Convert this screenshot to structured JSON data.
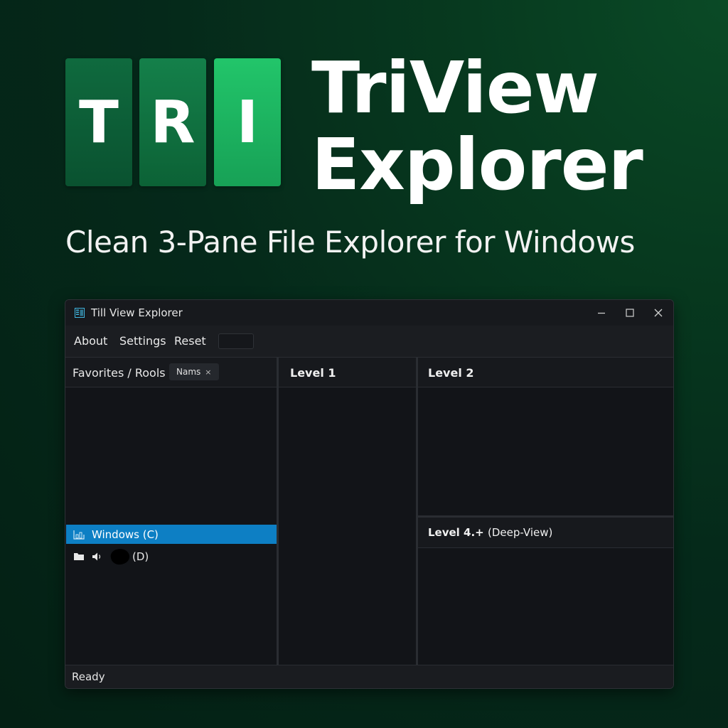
{
  "logo": {
    "letters": [
      "T",
      "R",
      "I"
    ],
    "colors": [
      "#0f6a3e",
      "#14804a",
      "#22c56a"
    ]
  },
  "brand": {
    "line1": "TriView",
    "line2": "Explorer"
  },
  "tagline": "Clean 3-Pane File Explorer for Windows",
  "window": {
    "title": "Till View Explorer",
    "icon": "app-window-icon",
    "controls": {
      "minimize": "—",
      "maximize": "☐",
      "close": "✕"
    }
  },
  "menu": {
    "about": "About",
    "settings": "Settings",
    "reset": "Reset"
  },
  "panes": {
    "favorites": {
      "title": "Favorites / Rools",
      "chip_label": "Nams",
      "chip_close": "×",
      "items": [
        {
          "label": "Windows (C)",
          "selected": true,
          "icon": "drive-icon"
        },
        {
          "label": "(D)",
          "selected": false,
          "icons": [
            "folder-icon",
            "speaker-icon"
          ]
        }
      ]
    },
    "level1": {
      "title": "Level 1"
    },
    "level2": {
      "title": "Level 2"
    },
    "level4": {
      "title": "Level 4.+",
      "subtitle": "(Deep-View)"
    }
  },
  "status": {
    "text": "Ready"
  },
  "colors": {
    "background": "#05291a",
    "window_bg": "#121418",
    "accent_selection": "#0d7fc4",
    "logo_light_green": "#22c56a"
  }
}
